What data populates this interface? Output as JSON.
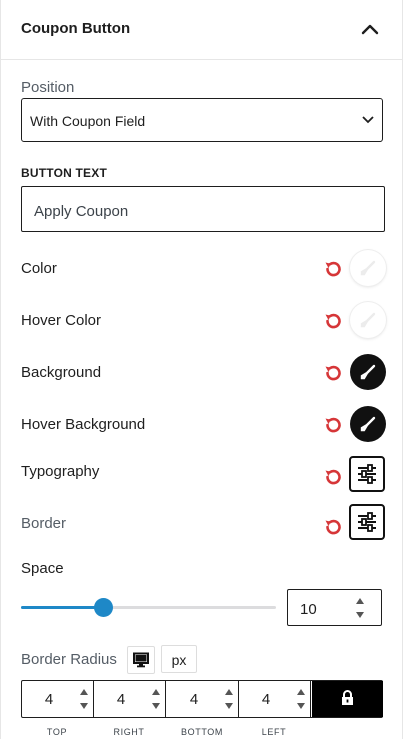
{
  "panel": {
    "title": "Coupon Button",
    "collapse_icon": "chevron-up-icon"
  },
  "position": {
    "label": "Position",
    "value": "With Coupon Field"
  },
  "button_text": {
    "label": "BUTTON TEXT",
    "value": "Apply Coupon"
  },
  "colors": [
    {
      "label": "Color",
      "swatch": "#ffffff"
    },
    {
      "label": "Hover Color",
      "swatch": "#ffffff"
    },
    {
      "label": "Background",
      "swatch": "#111111"
    },
    {
      "label": "Hover Background",
      "swatch": "#111111"
    }
  ],
  "typography": {
    "label": "Typography"
  },
  "border": {
    "label": "Border"
  },
  "space": {
    "label": "Space",
    "value": "10",
    "slider_fraction": 0.32
  },
  "border_radius": {
    "label": "Border Radius",
    "unit": "px",
    "device_icon": "desktop-icon",
    "top": "4",
    "right": "4",
    "bottom": "4",
    "left": "4",
    "labels": {
      "top": "TOP",
      "right": "RIGHT",
      "bottom": "BOTTOM",
      "left": "LEFT"
    }
  },
  "accent": {
    "reset": "#d63638",
    "slider": "#1e88c7"
  }
}
